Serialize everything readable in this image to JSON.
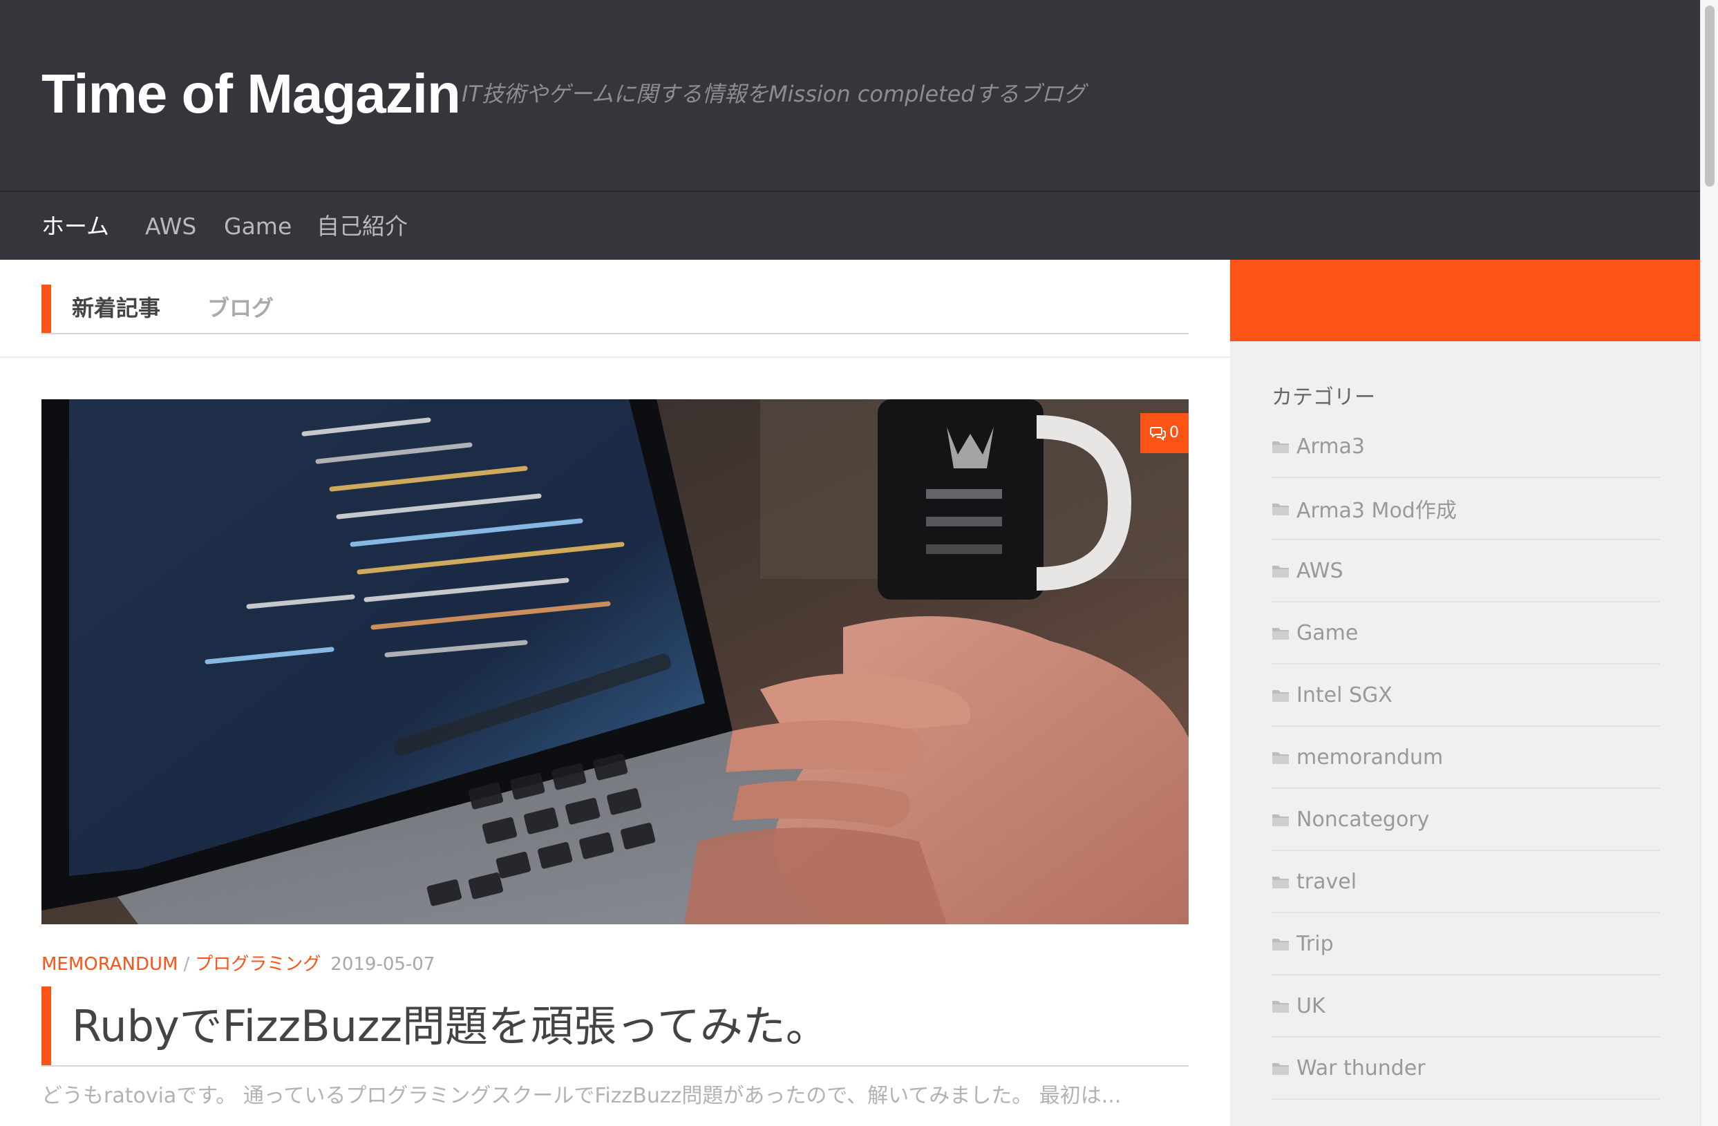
{
  "header": {
    "site_title": "Time of Magazin",
    "tagline": "IT技術やゲームに関する情報をMission completedするブログ"
  },
  "nav": {
    "items": [
      {
        "label": "ホーム",
        "active": true
      },
      {
        "label": "AWS",
        "active": false
      },
      {
        "label": "Game",
        "active": false
      },
      {
        "label": "自己紹介",
        "active": false
      }
    ]
  },
  "main": {
    "section_label": "新着記事",
    "section_sub": "ブログ",
    "post": {
      "image": "laptop-coding-photo",
      "comment_icon": "comments-icon",
      "comment_count": "0",
      "categories": [
        "MEMORANDUM",
        "プログラミング"
      ],
      "category_separator": "/",
      "date": "2019-05-07",
      "title": "RubyでFizzBuzz問題を頑張ってみた。",
      "excerpt": "どうもratoviaです。 通っているプログラミングスクールでFizzBuzz問題があったので、解いてみました。 最初は..."
    }
  },
  "sidebar": {
    "widget_title": "カテゴリー",
    "category_icon": "folder-icon",
    "categories": [
      "Arma3",
      "Arma3 Mod作成",
      "AWS",
      "Game",
      "Intel SGX",
      "memorandum",
      "Noncategory",
      "travel",
      "Trip",
      "UK",
      "War thunder"
    ]
  },
  "colors": {
    "accent": "#fc5317",
    "header_bg": "#34363b",
    "sidebar_bg": "#f0f0f0"
  }
}
